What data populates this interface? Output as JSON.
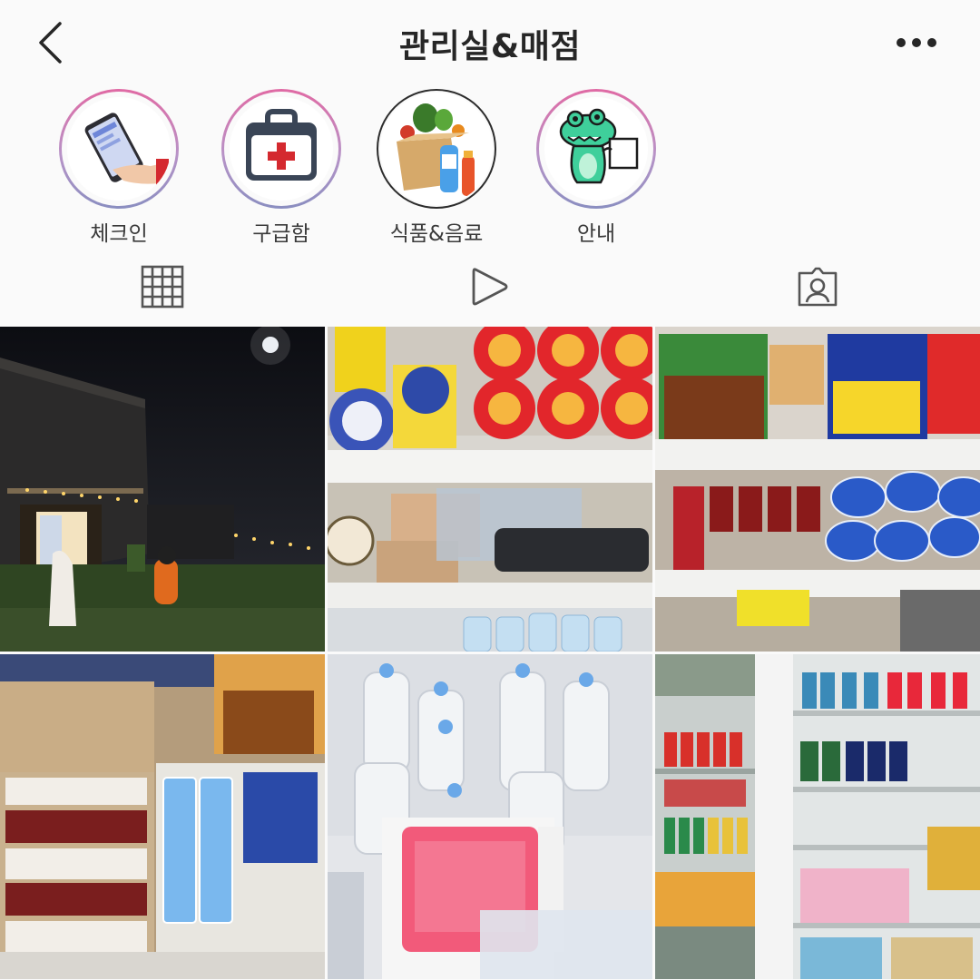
{
  "header": {
    "title": "관리실&매점",
    "back_icon": "chevron-left-icon",
    "more_icon": "more-horizontal-icon"
  },
  "highlights": [
    {
      "label": "체크인",
      "icon": "phone-in-hand-icon",
      "ring": "gradient"
    },
    {
      "label": "구급함",
      "icon": "first-aid-kit-icon",
      "ring": "gradient"
    },
    {
      "label": "식품&음료",
      "icon": "grocery-box-icon",
      "ring": "plain"
    },
    {
      "label": "안내",
      "icon": "crocodile-mascot-icon",
      "ring": "gradient"
    }
  ],
  "tabs": [
    {
      "name": "posts-grid",
      "icon": "grid-icon",
      "active": true
    },
    {
      "name": "reels",
      "icon": "play-icon",
      "active": false
    },
    {
      "name": "tagged",
      "icon": "person-tag-icon",
      "active": false
    }
  ],
  "posts": [
    {
      "subject": "night-building-photo"
    },
    {
      "subject": "ramen-shelf-photo"
    },
    {
      "subject": "noodle-and-gas-shelf-photo"
    },
    {
      "subject": "ice-cream-freezer-photo"
    },
    {
      "subject": "water-freezer-photo"
    },
    {
      "subject": "drinks-fridge-photo"
    }
  ],
  "colors": {
    "ring_gradient_top": "#e06aa4",
    "ring_gradient_bottom": "#8a8ec0",
    "icon_gray": "#555555",
    "background": "#fafafa"
  }
}
